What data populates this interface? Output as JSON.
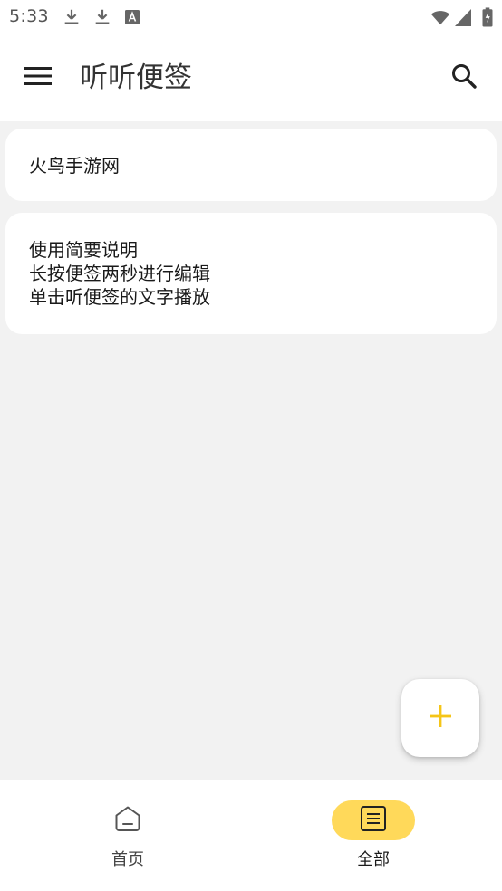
{
  "status_bar": {
    "time": "5:33",
    "icons": [
      "download-icon",
      "download-icon",
      "a-letter-icon",
      "wifi-icon",
      "signal-icon",
      "battery-icon"
    ]
  },
  "app_bar": {
    "title": "听听便签",
    "menu_icon": "menu-icon",
    "search_icon": "search-icon"
  },
  "notes": [
    {
      "text": "火鸟手游网"
    },
    {
      "text": "使用简要说明\n长按便签两秒进行编辑\n单击听便签的文字播放"
    }
  ],
  "fab": {
    "icon": "plus-icon",
    "color": "#f5c518"
  },
  "bottom_nav": {
    "items": [
      {
        "label": "首页",
        "icon": "home-icon",
        "selected": false
      },
      {
        "label": "全部",
        "icon": "notes-list-icon",
        "selected": true
      }
    ],
    "accent": "#ffd95a"
  }
}
